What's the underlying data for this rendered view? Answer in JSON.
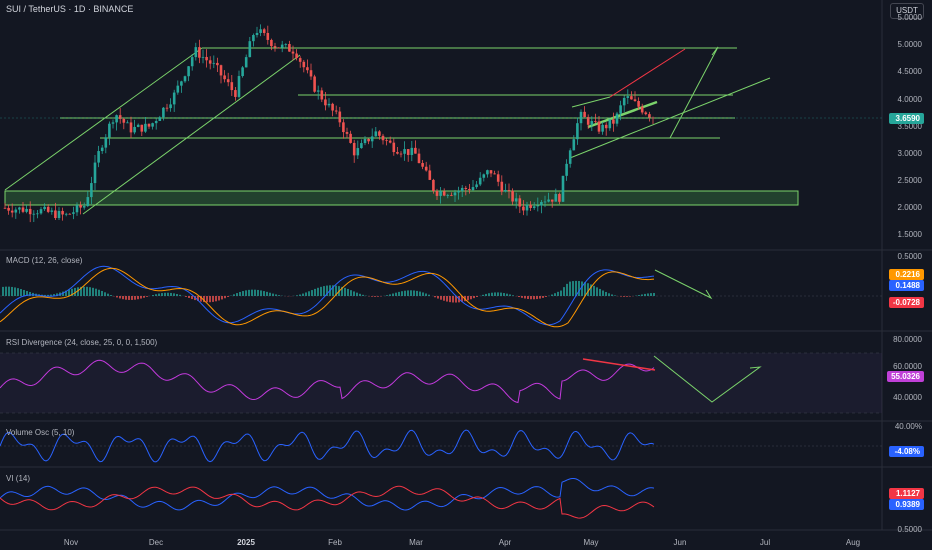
{
  "header": {
    "symbol_title": "SUI / TetherUS · 1D · BINANCE",
    "currency_button": "USDT"
  },
  "colors": {
    "background": "#131722",
    "up_candle": "#26a69a",
    "down_candle": "#ef5350",
    "annotation_green": "#7bd36b",
    "annotation_red": "#f23645",
    "macd_line": "#2962ff",
    "signal_line": "#ff9800",
    "rsi_line": "#e040fb",
    "volume_osc_line": "#2962ff",
    "vi_plus": "#2962ff",
    "vi_minus": "#f23645"
  },
  "price_pane": {
    "axis_labels": [
      "5.0000",
      "4.5000",
      "4.0000",
      "3.5000",
      "3.0000",
      "2.5000",
      "2.0000",
      "1.5000"
    ],
    "current_price": "3.6590"
  },
  "macd_pane": {
    "label": "MACD (12, 26, close)",
    "axis_labels": [
      "0.5000"
    ],
    "macd_value": "0.2216",
    "signal_value": "0.1488",
    "hist_value": "-0.0728"
  },
  "rsi_pane": {
    "label": "RSI Divergence (24, close, 25, 0, 0, 1,500)",
    "axis_labels": [
      "80.0000",
      "60.0000",
      "40.0000"
    ],
    "value": "55.0326"
  },
  "volume_osc_pane": {
    "label": "Volume Osc (5, 10)",
    "axis_labels": [
      "40.00%"
    ],
    "value": "-4.08%"
  },
  "vi_pane": {
    "label": "VI (14)",
    "axis_labels": [
      "0.5000"
    ],
    "vi_plus_value": "0.9389",
    "vi_minus_value": "1.1127"
  },
  "x_axis": {
    "labels": [
      "Nov",
      "Dec",
      "2025",
      "Feb",
      "Mar",
      "Apr",
      "May",
      "Jun",
      "Jul",
      "Aug"
    ]
  }
}
